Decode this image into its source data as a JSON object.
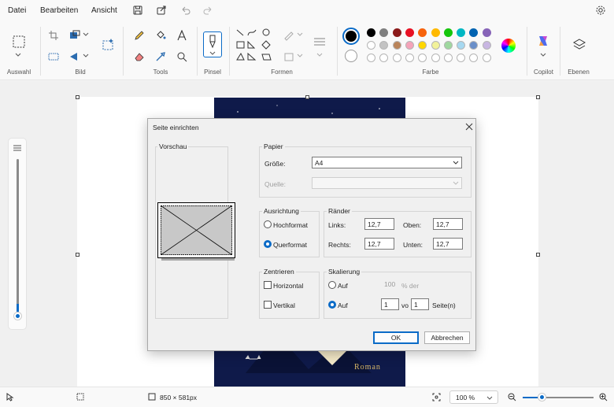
{
  "menu": {
    "file": "Datei",
    "edit": "Bearbeiten",
    "view": "Ansicht"
  },
  "ribbon": {
    "groups": {
      "selection": "Auswahl",
      "image": "Bild",
      "tools": "Tools",
      "brush": "Pinsel",
      "shapes": "Formen",
      "colors": "Farbe",
      "copilot": "Copilot",
      "layers": "Ebenen"
    },
    "palette_row1": [
      "#000000",
      "#7f7f7f",
      "#8b1a1a",
      "#e81123",
      "#f7630c",
      "#ffb900",
      "#16c60c",
      "#00b7c3",
      "#0063b1",
      "#8764b8"
    ],
    "palette_row2": [
      "#ffffff",
      "#c3c3c3",
      "#b9845a",
      "#f4a3b9",
      "#ffd700",
      "#f2f29a",
      "#9fd89f",
      "#a6d8f0",
      "#6a8fc9",
      "#c8b6e2"
    ]
  },
  "cover": {
    "subtitle": "Roman"
  },
  "dialog": {
    "title": "Seite einrichten",
    "preview_label": "Vorschau",
    "paper": {
      "label": "Papier",
      "size_label": "Größe:",
      "size_value": "A4",
      "source_label": "Quelle:",
      "source_value": ""
    },
    "orientation": {
      "label": "Ausrichtung",
      "portrait": "Hochformat",
      "landscape": "Querformat",
      "selected": "landscape"
    },
    "margins": {
      "label": "Ränder",
      "left_label": "Links:",
      "left": "12,7",
      "top_label": "Oben:",
      "top": "12,7",
      "right_label": "Rechts:",
      "right": "12,7",
      "bottom_label": "Unten:",
      "bottom": "12,7"
    },
    "center": {
      "label": "Zentrieren",
      "horizontal": "Horizontal",
      "vertical": "Vertikal"
    },
    "scaling": {
      "label": "Skalierung",
      "adjust_label": "Auf",
      "adjust_value": "100",
      "percent_suffix": "% der",
      "fit_label": "Auf",
      "fit_wide": "1",
      "of_label": "vo",
      "fit_tall": "1",
      "pages_suffix": "Seite(n)"
    },
    "ok": "OK",
    "cancel": "Abbrechen"
  },
  "statusbar": {
    "dimensions": "850 × 581px",
    "zoom": "100 %"
  },
  "zoom_level_percent": 100
}
